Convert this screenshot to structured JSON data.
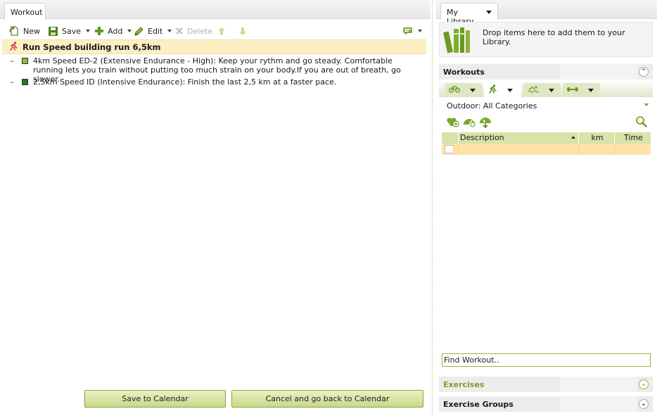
{
  "workout_panel": {
    "tab_label": "Workout",
    "toolbar": {
      "new_label": "New",
      "save_label": "Save",
      "add_label": "Add",
      "edit_label": "Edit",
      "delete_label": "Delete"
    },
    "workout_title": "Run Speed building run 6,5km",
    "segments": [
      {
        "bullet": "–",
        "color": "#8fbf1f",
        "text": "4km Speed ED-2 (Extensive Endurance - High): Keep your rythm and go steady. Comfortable running lets you train without putting too much strain on your body.If you are out of breath, go slower."
      },
      {
        "bullet": "–",
        "color": "#1d7a1d",
        "text": "2,5km Speed ID (Intensive Endurance): Finish the last 2,5 km at a faster pace."
      }
    ],
    "save_to_calendar_label": "Save to Calendar",
    "cancel_label": "Cancel and go back to Calendar"
  },
  "library_panel": {
    "tab_label": "My Library",
    "drop_message": "Drop items here to add them to your Library.",
    "workouts_section": "Workouts",
    "filter_label": "Outdoor: All Categories",
    "grid": {
      "columns": [
        "Description",
        "km",
        "Time"
      ]
    },
    "find_value": "Find Workout..",
    "exercises_section": "Exercises",
    "exercise_groups_section": "Exercise Groups"
  },
  "colors": {
    "accent_green": "#7f9e2a",
    "header_highlight": "#fbefc3",
    "grid_header": "#d7e3a8",
    "grid_row_selected": "#fde3a8",
    "run_icon": "#d0354c"
  },
  "icons": {
    "new": "new-document-icon",
    "save": "floppy-disk-icon",
    "add": "plus-icon",
    "edit": "pencil-icon",
    "delete": "x-icon",
    "move_up": "arrow-up-icon",
    "move_down": "arrow-down-icon",
    "comment": "speech-bubble-icon",
    "runner": "runner-icon",
    "library": "books-icon"
  }
}
